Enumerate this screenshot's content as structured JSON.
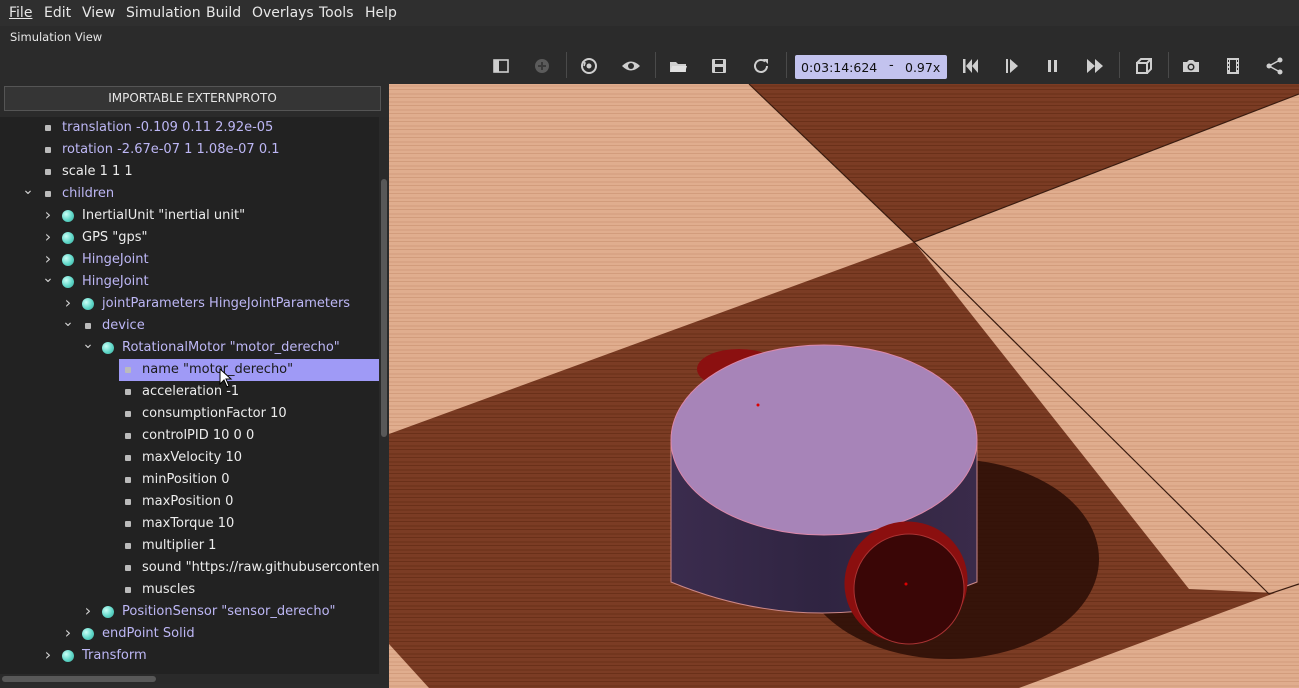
{
  "menu": [
    "File",
    "Edit",
    "View",
    "Simulation",
    "Build",
    "Overlays",
    "Tools",
    "Help"
  ],
  "view_title": "Simulation View",
  "toolbar": {
    "time": "0:03:14:624",
    "speed_sep": "-",
    "speed": "0.97x",
    "icons": [
      "toggle-panel-icon",
      "add-node-icon",
      "reset-view-icon",
      "eye-icon",
      "open-folder-icon",
      "save-icon",
      "reload-icon",
      "step-back-icon",
      "step-icon",
      "pause-icon",
      "fast-forward-icon",
      "view-cube-icon",
      "camera-icon",
      "film-icon",
      "share-icon"
    ]
  },
  "panel": {
    "button": "IMPORTABLE EXTERNPROTO",
    "tree": [
      {
        "label": "translation -0.109 0.11 2.92e-05",
        "color": "purple",
        "icon": "dot",
        "depth": 0,
        "arrow": ""
      },
      {
        "label": "rotation -2.67e-07 1 1.08e-07 0.1",
        "color": "purple",
        "icon": "dot",
        "depth": 0,
        "arrow": ""
      },
      {
        "label": "scale 1 1 1",
        "color": "white",
        "icon": "dot",
        "depth": 0,
        "arrow": ""
      },
      {
        "label": "children",
        "color": "purple",
        "icon": "dot",
        "depth": 0,
        "arrow": "v"
      },
      {
        "label": "InertialUnit \"inertial unit\"",
        "color": "white",
        "icon": "ball",
        "depth": 1,
        "arrow": ">"
      },
      {
        "label": "GPS \"gps\"",
        "color": "white",
        "icon": "ball",
        "depth": 1,
        "arrow": ">"
      },
      {
        "label": "HingeJoint",
        "color": "purple",
        "icon": "ball",
        "depth": 1,
        "arrow": ">"
      },
      {
        "label": "HingeJoint",
        "color": "purple",
        "icon": "ball",
        "depth": 1,
        "arrow": "v"
      },
      {
        "label": "jointParameters HingeJointParameters",
        "color": "purple",
        "icon": "ball",
        "depth": 2,
        "arrow": ">"
      },
      {
        "label": "device",
        "color": "purple",
        "icon": "dot",
        "depth": 2,
        "arrow": "v"
      },
      {
        "label": "RotationalMotor \"motor_derecho\"",
        "color": "purple",
        "icon": "ball",
        "depth": 3,
        "arrow": "v"
      },
      {
        "label": "name \"motor_derecho\"",
        "color": "white",
        "icon": "dot",
        "depth": 4,
        "arrow": "",
        "selected": true
      },
      {
        "label": "acceleration -1",
        "color": "white",
        "icon": "dot",
        "depth": 4,
        "arrow": ""
      },
      {
        "label": "consumptionFactor 10",
        "color": "white",
        "icon": "dot",
        "depth": 4,
        "arrow": ""
      },
      {
        "label": "controlPID 10 0 0",
        "color": "white",
        "icon": "dot",
        "depth": 4,
        "arrow": ""
      },
      {
        "label": "maxVelocity 10",
        "color": "white",
        "icon": "dot",
        "depth": 4,
        "arrow": ""
      },
      {
        "label": "minPosition 0",
        "color": "white",
        "icon": "dot",
        "depth": 4,
        "arrow": ""
      },
      {
        "label": "maxPosition 0",
        "color": "white",
        "icon": "dot",
        "depth": 4,
        "arrow": ""
      },
      {
        "label": "maxTorque 10",
        "color": "white",
        "icon": "dot",
        "depth": 4,
        "arrow": ""
      },
      {
        "label": "multiplier 1",
        "color": "white",
        "icon": "dot",
        "depth": 4,
        "arrow": ""
      },
      {
        "label": "sound \"https://raw.githubusercontent.c",
        "color": "white",
        "icon": "dot",
        "depth": 4,
        "arrow": ""
      },
      {
        "label": "muscles",
        "color": "white",
        "icon": "dot",
        "depth": 4,
        "arrow": ""
      },
      {
        "label": "PositionSensor \"sensor_derecho\"",
        "color": "purple",
        "icon": "ball",
        "depth": 3,
        "arrow": ">"
      },
      {
        "label": "endPoint Solid",
        "color": "purple",
        "icon": "ball",
        "depth": 2,
        "arrow": ">"
      },
      {
        "label": "Transform",
        "color": "purple",
        "icon": "ball",
        "depth": 1,
        "arrow": ">"
      }
    ]
  },
  "colors": {
    "selection": "#9f9af6",
    "label_purple": "#bdb7f5",
    "time_box": "#c3c3ee",
    "robot_body": "#a784b8",
    "wheel": "#8b0f0f"
  }
}
